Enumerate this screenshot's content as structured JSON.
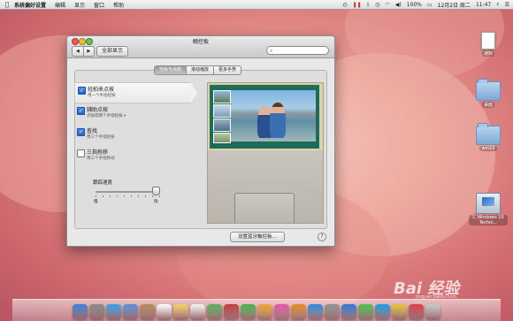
{
  "menubar": {
    "apple_icon": "apple-icon",
    "app_name": "系统偏好设置",
    "items": [
      "编辑",
      "显示",
      "窗口",
      "帮助"
    ],
    "status": {
      "battery": "100%",
      "datetime": "12月2日 周二",
      "time": "11:47"
    }
  },
  "desktop": {
    "icons": [
      {
        "label": "通知",
        "type": "doc"
      },
      {
        "label": "桌面",
        "type": "folder"
      },
      {
        "label": "win10",
        "type": "folder"
      },
      {
        "label": "C Windows 10 Techni...",
        "type": "drive"
      }
    ]
  },
  "window": {
    "title": "触控板",
    "show_all": "全部显示",
    "nav_back": "◀",
    "nav_fwd": "▶",
    "search": {
      "value": "",
      "placeholder": ""
    },
    "tabs": [
      {
        "label": "光标与点按",
        "selected": true
      },
      {
        "label": "滚动缩放",
        "selected": false
      },
      {
        "label": "更多手势",
        "selected": false
      }
    ],
    "options": [
      {
        "title": "轻拍来点按",
        "desc": "用一个手指轻按",
        "checked": true,
        "selected": true
      },
      {
        "title": "辅助点按",
        "desc": "点按或两个手指轻按",
        "checked": true,
        "selected": false,
        "has_dropdown": true
      },
      {
        "title": "查找",
        "desc": "用三个手指轻按",
        "checked": true,
        "selected": false
      },
      {
        "title": "三指拖移",
        "desc": "用三个手指移动",
        "checked": false,
        "selected": false
      }
    ],
    "tracking": {
      "label": "跟踪速度",
      "slow": "慢",
      "fast": "快",
      "value": 0.95
    },
    "bluetooth_button": "设置蓝牙触控板...",
    "help_icon": "?"
  },
  "watermark": {
    "text": "Bai 经验",
    "sub": "jingyan.baidu.com"
  },
  "dock": {
    "icons": [
      "finder-icon",
      "launchpad-icon",
      "safari-icon",
      "mail-icon",
      "contacts-icon",
      "calendar-icon",
      "notes-icon",
      "reminders-icon",
      "maps-icon",
      "photobooth-icon",
      "facetime-icon",
      "photos-icon",
      "itunes-icon",
      "ibooks-icon",
      "appstore-icon",
      "preferences-icon",
      "xcode-icon",
      "wechat-icon",
      "qq-icon",
      "chrome-icon",
      "music-icon",
      "trash-icon"
    ]
  }
}
